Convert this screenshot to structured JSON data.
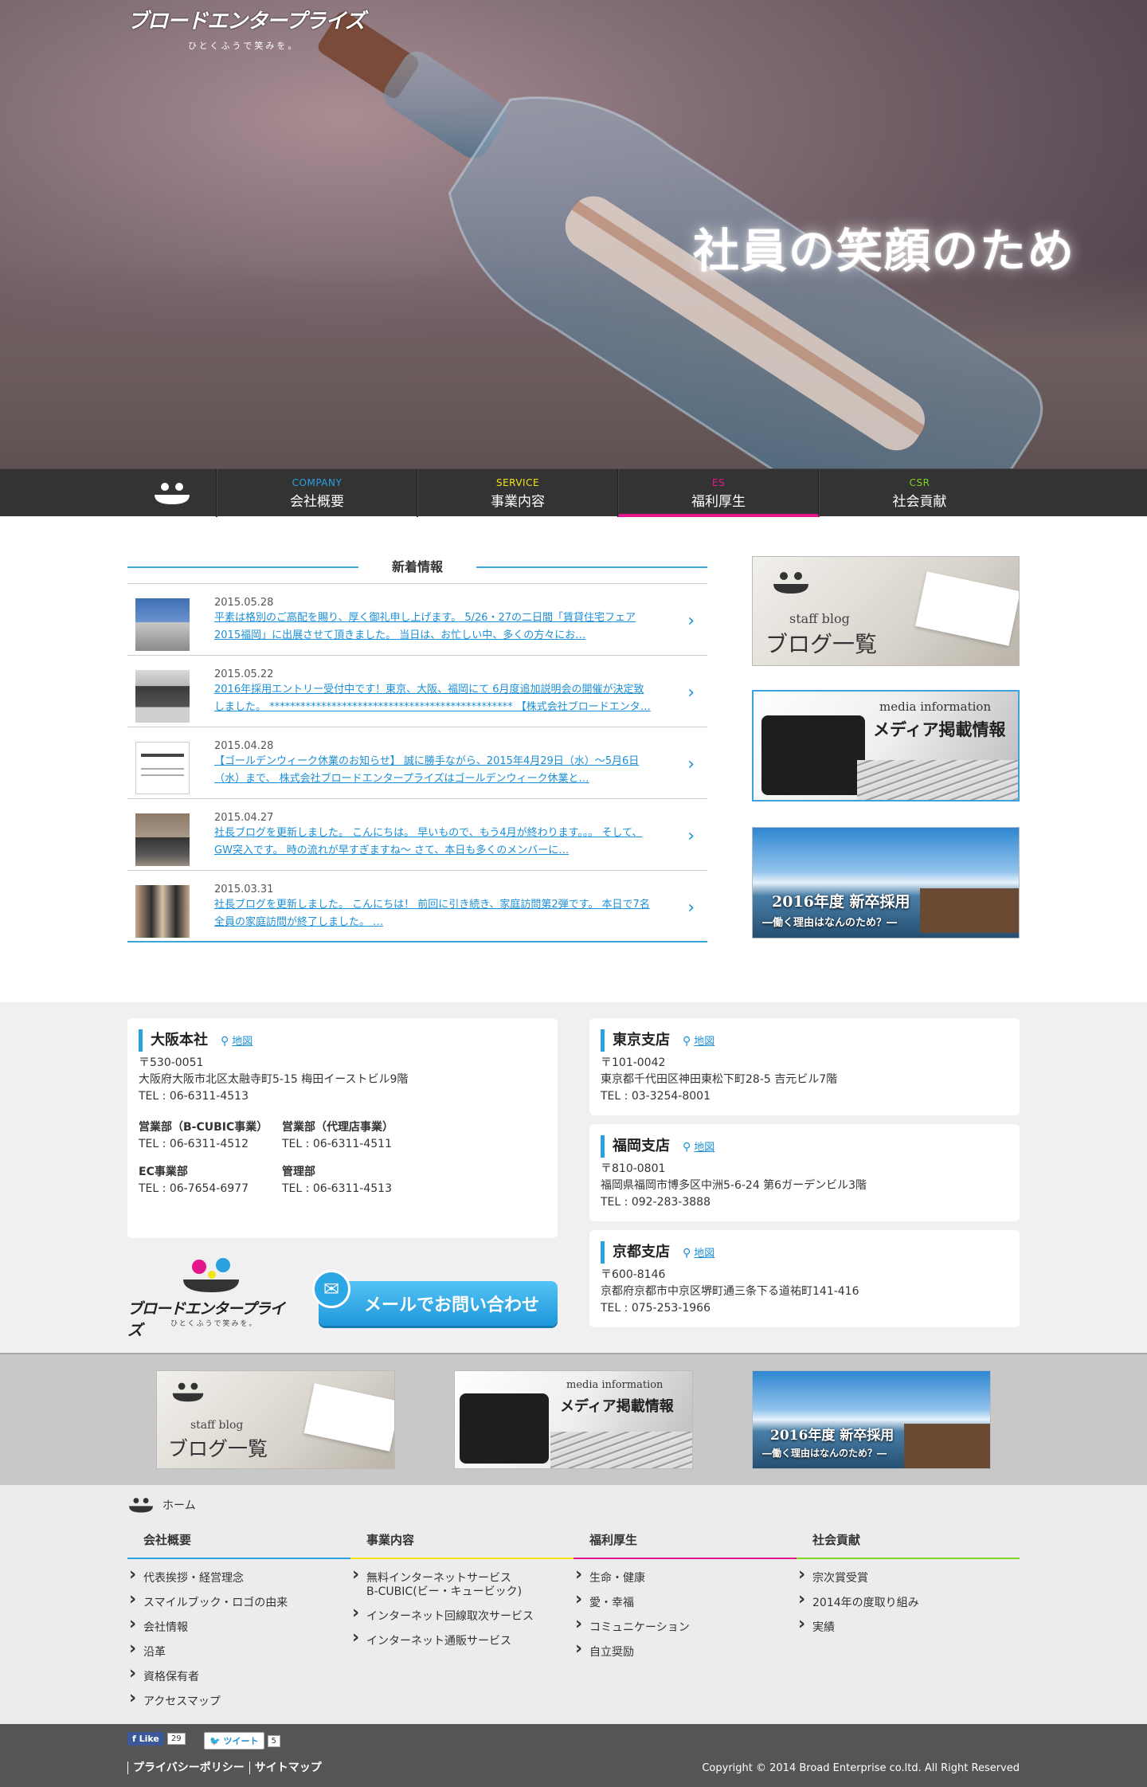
{
  "brand": {
    "name": "ブロードエンタープライズ",
    "tagline": "ひとくふうで笑みを。"
  },
  "hero": {
    "caption": "社員の笑顔のため"
  },
  "nav": {
    "items": [
      {
        "en": "COMPANY",
        "jp": "会社概要",
        "color": "#2aa0e0"
      },
      {
        "en": "SERVICE",
        "jp": "事業内容",
        "color": "#f2e415"
      },
      {
        "en": "ES",
        "jp": "福利厚生",
        "color": "#e5168c"
      },
      {
        "en": "CSR",
        "jp": "社会貢献",
        "color": "#7fd321"
      }
    ],
    "active": "ES"
  },
  "news": {
    "heading": "新着情報",
    "items": [
      {
        "date": "2015.05.28",
        "text": "平素は格別のご高配を賜り、厚く御礼申し上げます。 5/26・27の二日間「賃貸住宅フェア2015福岡」に出展させて頂きました。 当日は、お忙しい中、多くの方々にお…"
      },
      {
        "date": "2015.05.22",
        "text": "2016年採用エントリー受付中です！東京、大阪、福岡にて 6月度追加説明会の開催が決定致しました。 *********************************************** 【株式会社ブロードエンタ…"
      },
      {
        "date": "2015.04.28",
        "text": "【ゴールデンウィーク休業のお知らせ】 誠に勝手ながら、2015年4月29日（水）〜5月6日（水）まで、 株式会社ブロードエンタープライズはゴールデンウィーク休業と…"
      },
      {
        "date": "2015.04.27",
        "text": "社長ブログを更新しました。 こんにちは。 早いもので、もう4月が終わります。。。 そして、GW突入です。 時の流れが早すぎますね〜 さて、本日も多くのメンバーに…"
      },
      {
        "date": "2015.03.31",
        "text": "社長ブログを更新しました。 こんにちは！ 前回に引き続き、家庭訪問第2弾です。 本日で7名全員の家庭訪問が終了しました。 …"
      }
    ]
  },
  "banners": {
    "blog": {
      "en": "staff blog",
      "jp": "ブログ一覧"
    },
    "media": {
      "en": "media information",
      "jp": "メディア掲載情報"
    },
    "recruit": {
      "jp": "2016年度 新卒採用",
      "sub": "―働く理由はなんのため？―"
    }
  },
  "offices": {
    "map_label": "地図",
    "osaka": {
      "name": "大阪本社",
      "zip": "〒530-0051",
      "address": "大阪府大阪市北区太融寺町5-15 梅田イーストビル9階",
      "tel": "TEL : 06-6311-4513",
      "depts": [
        {
          "name": "営業部（B-CUBIC事業）",
          "tel": "TEL : 06-6311-4512"
        },
        {
          "name": "営業部（代理店事業）",
          "tel": "TEL : 06-6311-4511"
        },
        {
          "name": "EC事業部",
          "tel": "TEL : 06-7654-6977"
        },
        {
          "name": "管理部",
          "tel": "TEL : 06-6311-4513"
        }
      ]
    },
    "tokyo": {
      "name": "東京支店",
      "zip": "〒101-0042",
      "address": "東京都千代田区神田東松下町28-5 吉元ビル7階",
      "tel": "TEL : 03-3254-8001"
    },
    "fukuoka": {
      "name": "福岡支店",
      "zip": "〒810-0801",
      "address": "福岡県福岡市博多区中洲5-6-24 第6ガーデンビル3階",
      "tel": "TEL : 092-283-3888"
    },
    "kyoto": {
      "name": "京都支店",
      "zip": "〒600-8146",
      "address": "京都府京都市中京区堺町通三条下る道祐町141-416",
      "tel": "TEL : 075-253-1966"
    }
  },
  "contact": {
    "label": "メールでお問い合わせ"
  },
  "sitemap": {
    "home": "ホーム",
    "columns": [
      {
        "title": "会社概要",
        "color": "#2aa0e0",
        "items": [
          "代表挨拶・経営理念",
          "スマイルブック・ロゴの由来",
          "会社情報",
          "沿革",
          "資格保有者",
          "アクセスマップ"
        ]
      },
      {
        "title": "事業内容",
        "color": "#f2e415",
        "items": [
          "無料インターネットサービス B-CUBIC(ビー・キュービック)",
          "インターネット回線取次サービス",
          "インターネット通販サービス"
        ]
      },
      {
        "title": "福利厚生",
        "color": "#e5168c",
        "items": [
          "生命・健康",
          "愛・幸福",
          "コミュニケーション",
          "自立奨励"
        ]
      },
      {
        "title": "社会貢献",
        "color": "#7fd321",
        "items": [
          "宗次賞受賞",
          "2014年の度取り組み",
          "実績"
        ]
      }
    ]
  },
  "footer": {
    "fb_label": "Like",
    "fb_count": "29",
    "tw_label": "ツイート",
    "tw_count": "5",
    "links": [
      "プライバシーポリシー",
      "サイトマップ"
    ],
    "copyright": "Copyright © 2014 Broad Enterprise co.ltd. All Right Reserved"
  }
}
